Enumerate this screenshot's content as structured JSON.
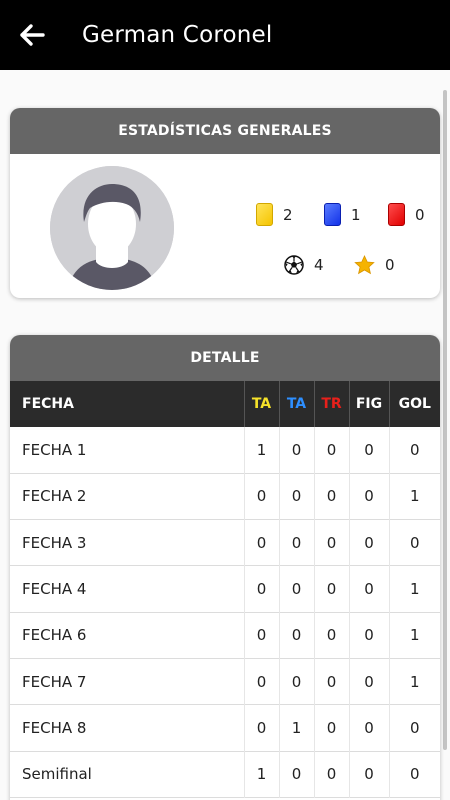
{
  "header": {
    "title": "German Coronel"
  },
  "stats": {
    "title": "ESTADÍSTICAS GENERALES",
    "yellow": "2",
    "blue": "1",
    "red": "0",
    "goals": "4",
    "stars": "0"
  },
  "detail": {
    "title": "DETALLE",
    "columns": [
      "FECHA",
      "TA",
      "TA",
      "TR",
      "FIG",
      "GOL"
    ],
    "rows": [
      [
        "FECHA 1",
        "1",
        "0",
        "0",
        "0",
        "0"
      ],
      [
        "FECHA 2",
        "0",
        "0",
        "0",
        "0",
        "1"
      ],
      [
        "FECHA 3",
        "0",
        "0",
        "0",
        "0",
        "0"
      ],
      [
        "FECHA 4",
        "0",
        "0",
        "0",
        "0",
        "1"
      ],
      [
        "FECHA 6",
        "0",
        "0",
        "0",
        "0",
        "1"
      ],
      [
        "FECHA 7",
        "0",
        "0",
        "0",
        "0",
        "1"
      ],
      [
        "FECHA 8",
        "0",
        "1",
        "0",
        "0",
        "0"
      ],
      [
        "Semifinal",
        "1",
        "0",
        "0",
        "0",
        "0"
      ]
    ]
  },
  "colors": {
    "topbar": "#000000",
    "card_header": "#666666",
    "table_header": "#2b2b2b",
    "ta_yellow": "#f6e22a",
    "ta_blue": "#2e8fff",
    "tr_red": "#e8201b"
  }
}
